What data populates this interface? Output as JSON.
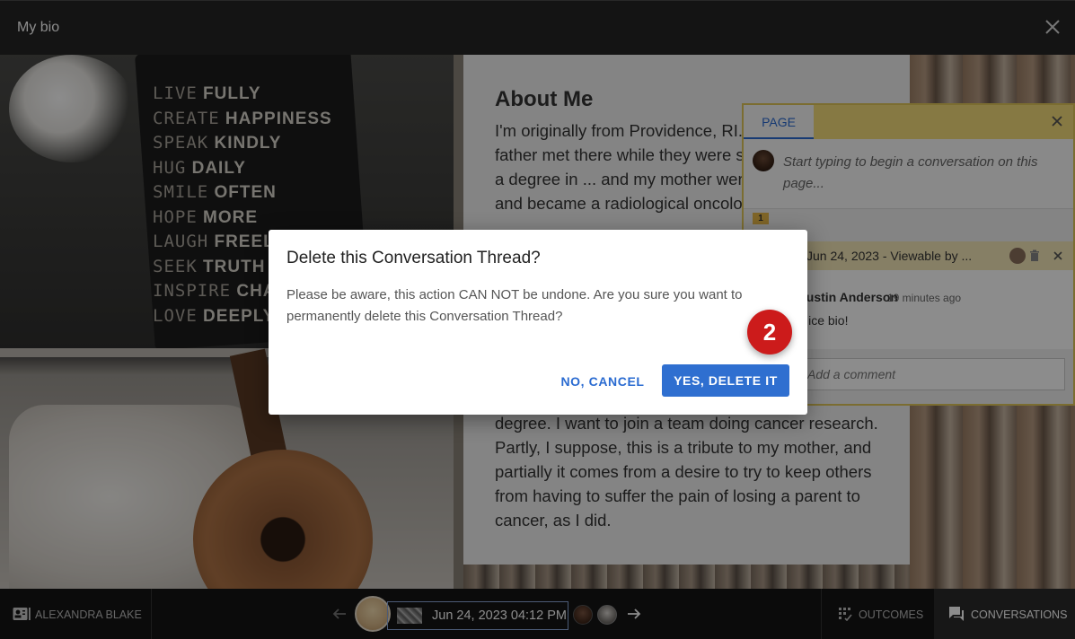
{
  "header": {
    "title": "My bio"
  },
  "photo": {
    "sign_lines": [
      [
        "LIVE",
        "FULLY"
      ],
      [
        "CREATE",
        "HAPPINESS"
      ],
      [
        "SPEAK",
        "KINDLY"
      ],
      [
        "HUG",
        "DAILY"
      ],
      [
        "SMILE",
        "OFTEN"
      ],
      [
        "HOPE",
        "MORE"
      ],
      [
        "LAUGH",
        "FREELY"
      ],
      [
        "SEEK",
        "TRUTH"
      ],
      [
        "INSPIRE",
        "CHANGE"
      ],
      [
        "LOVE",
        "DEEPLY"
      ]
    ]
  },
  "bio": {
    "heading": "About Me",
    "text_top": "I'm originally from Providence, RI. My mother and father met there while they were students. Father got a degree in ... and my mother went to medical school and became a radiological oncologist...",
    "text_bottom": "degree. I want to join a team doing cancer research. Partly, I suppose, this is a tribute to my mother, and partially it comes from a desire to try to keep others from having to suffer the pain of losing a parent to cancer, as I did."
  },
  "conversation_panel": {
    "tab_label": "PAGE",
    "placeholder": "Start typing to begin a conversation on this page...",
    "count": "1",
    "thread_title": "Jun 24, 2023 - Viewable by ...",
    "comment_author": "Justin Anderson",
    "comment_time": "19 minutes ago",
    "comment_body": "Nice bio!",
    "reply_placeholder": "Add a comment"
  },
  "modal": {
    "title": "Delete this Conversation Thread?",
    "message": "Please be aware, this action CAN NOT be undone. Are you sure you want to permanently delete this Conversation Thread?",
    "cancel_label": "NO, CANCEL",
    "confirm_label": "YES, DELETE IT",
    "step_badge": "2"
  },
  "footer": {
    "user_label": "ALEXANDRA BLAKE",
    "date_label": "Jun 24, 2023 04:12 PM",
    "outcomes_label": "OUTCOMES",
    "conversations_label": "CONVERSATIONS"
  },
  "colors": {
    "accent_blue": "#2f6fd0",
    "badge_red": "#cc1b1b",
    "panel_yellow": "#f5dc7a"
  },
  "icons": {
    "header_close": "close-icon",
    "user": "id-card-icon",
    "prev": "arrow-left-icon",
    "next": "arrow-right-icon",
    "outcomes": "outcomes-grid-icon",
    "conversations": "chat-bubbles-icon",
    "trash": "trash-icon"
  }
}
